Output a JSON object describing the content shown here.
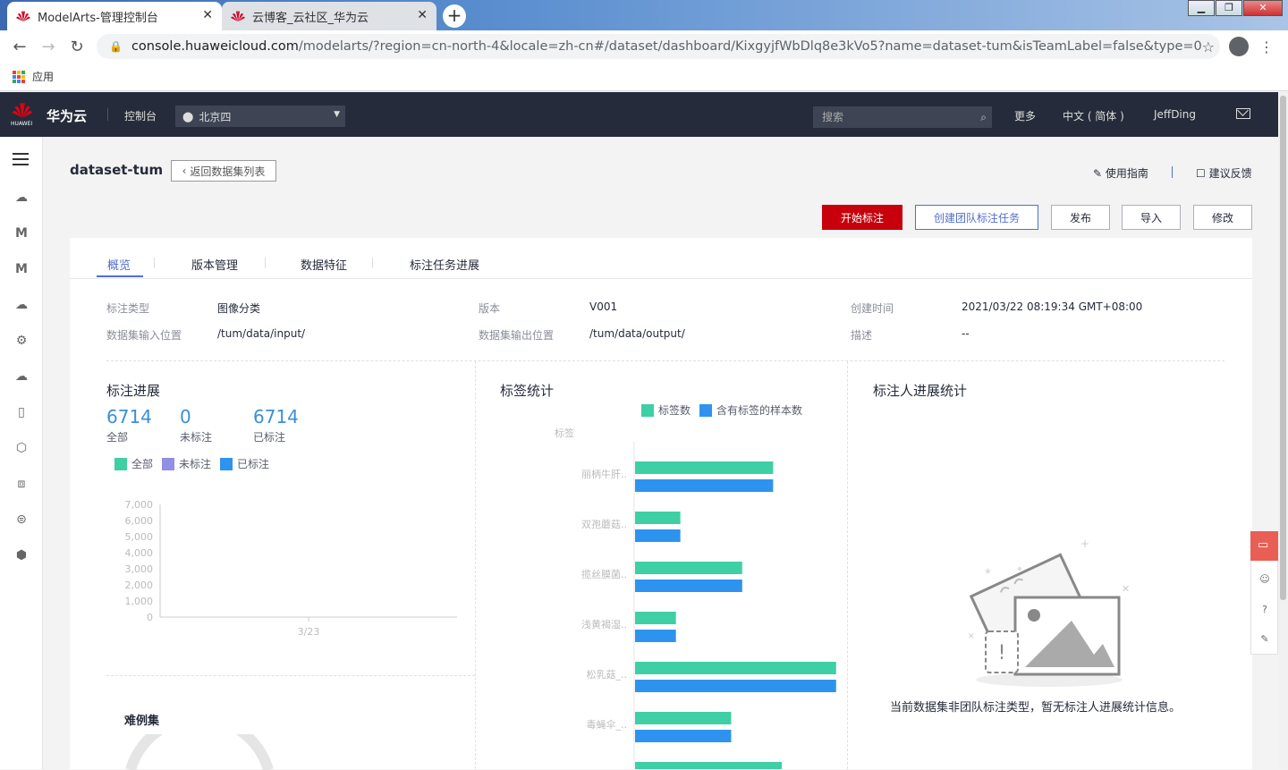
{
  "browser": {
    "tabs": [
      {
        "title": "ModelArts-管理控制台",
        "active": true
      },
      {
        "title": "云博客_云社区_华为云",
        "active": false
      }
    ],
    "url_host": "console.huaweicloud.com",
    "url_rest": "/modelarts/?region=cn-north-4&locale=zh-cn#/dataset/dashboard/KixgyjfWbDlq8e3kVo5?name=dataset-tum&isTeamLabel=false&type=0",
    "bookmarks_label": "应用"
  },
  "topbar": {
    "logo_text": "HUAWEI",
    "brand": "华为云",
    "console": "控制台",
    "region": "北京四",
    "search_placeholder": "搜索",
    "more": "更多",
    "language": "中文 ( 简体 )",
    "user": "JeffDing"
  },
  "page": {
    "title": "dataset-tum",
    "back_label": "返回数据集列表",
    "guide": "使用指南",
    "feedback": "建议反馈",
    "buttons": {
      "start_label": "开始标注",
      "team_task": "创建团队标注任务",
      "publish": "发布",
      "import": "导入",
      "modify": "修改"
    },
    "tabs": [
      "概览",
      "版本管理",
      "数据特征",
      "标注任务进展"
    ],
    "info": {
      "label_type_key": "标注类型",
      "label_type_val": "图像分类",
      "version_key": "版本",
      "version_val": "V001",
      "created_key": "创建时间",
      "created_val": "2021/03/22 08:19:34 GMT+08:00",
      "input_key": "数据集输入位置",
      "input_val": "/tum/data/input/",
      "output_key": "数据集输出位置",
      "output_val": "/tum/data/output/",
      "desc_key": "描述",
      "desc_val": "--"
    },
    "progress": {
      "title": "标注进展",
      "all_num": "6714",
      "all_label": "全部",
      "unlabeled_num": "0",
      "unlabeled_label": "未标注",
      "labeled_num": "6714",
      "labeled_label": "已标注",
      "legend": [
        "全部",
        "未标注",
        "已标注"
      ]
    },
    "tag_stats": {
      "title": "标签统计",
      "legend": [
        "标签数",
        "含有标签的样本数"
      ],
      "axis_label": "标签"
    },
    "annotator": {
      "title": "标注人进展统计",
      "empty": "当前数据集非团队标注类型，暂无标注人进展统计信息。"
    },
    "hard_examples": {
      "title": "难例集"
    }
  },
  "colors": {
    "accent": "#526ecc",
    "primary_red": "#c7000b",
    "green": "#3ecfa5",
    "blue": "#2e93ef",
    "purple": "#8f8fe6"
  },
  "chart_data": [
    {
      "type": "line",
      "series_names": [
        "全部",
        "未标注",
        "已标注"
      ],
      "x": [
        "3/23"
      ],
      "yticks": [
        "0",
        "1,000",
        "2,000",
        "3,000",
        "4,000",
        "5,000",
        "6,000",
        "7,000"
      ],
      "ylim": [
        0,
        7000
      ]
    },
    {
      "type": "bar",
      "orientation": "horizontal",
      "categories": [
        "丽柄牛肝..",
        "双孢蘑菇..",
        "揽丝膜菌..",
        "浅黄褐湿..",
        "松乳菇_..",
        "毒蝇伞_.."
      ],
      "series": [
        {
          "name": "标签数",
          "values": [
            1250,
            410,
            970,
            370,
            1820,
            870
          ]
        },
        {
          "name": "含有标签的样本数",
          "values": [
            1250,
            410,
            970,
            370,
            1820,
            870
          ]
        }
      ],
      "xlim": [
        0,
        2000
      ]
    }
  ]
}
